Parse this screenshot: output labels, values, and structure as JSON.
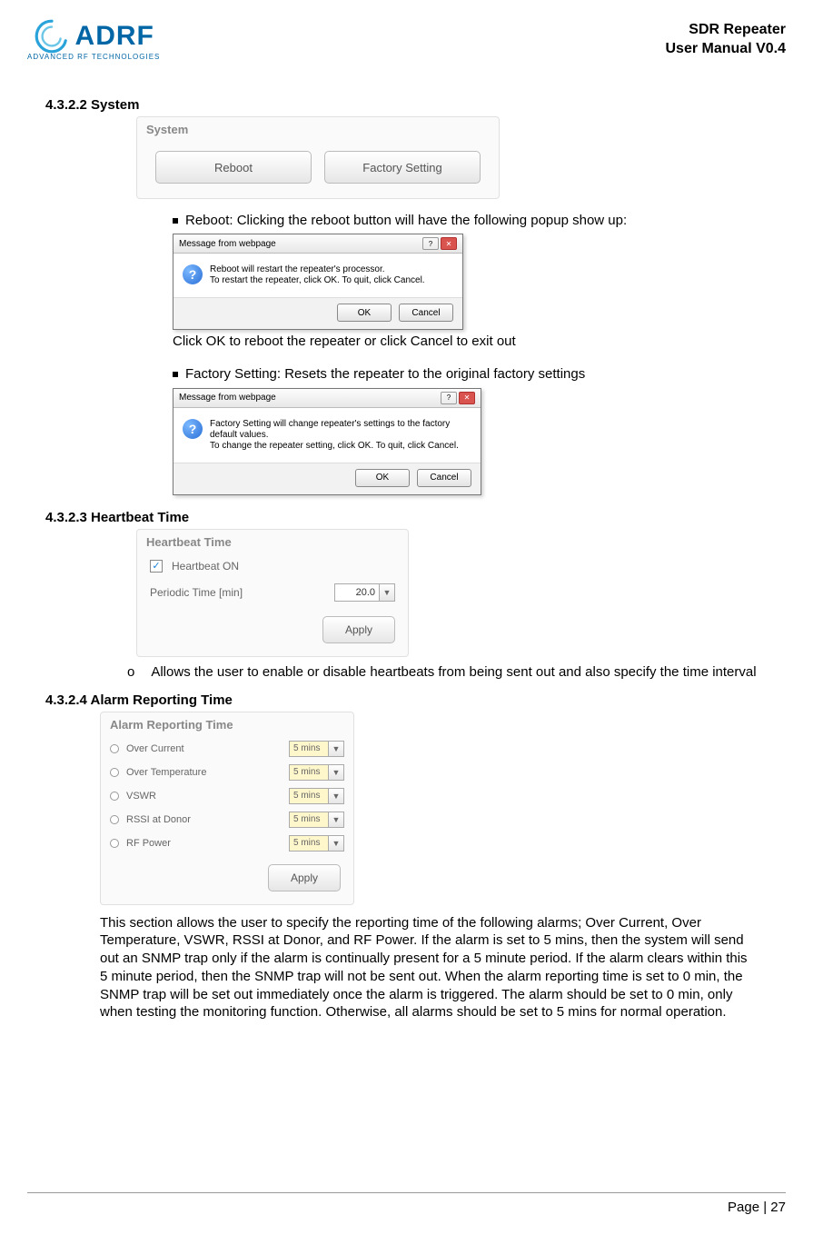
{
  "header": {
    "logo_text": "ADRF",
    "logo_sub": "ADVANCED RF TECHNOLOGIES",
    "title_line1": "SDR Repeater",
    "title_line2": "User Manual V0.4"
  },
  "sections": {
    "system": {
      "heading": "4.3.2.2 System",
      "panel_title": "System",
      "reboot_btn": "Reboot",
      "factory_btn": "Factory Setting",
      "reboot_bullet": "Reboot: Clicking the reboot button will have the following popup show up:",
      "reboot_popup": {
        "title": "Message from webpage",
        "line1": "Reboot will restart the repeater's processor.",
        "line2": "To restart the repeater, click OK. To quit, click Cancel.",
        "ok": "OK",
        "cancel": "Cancel"
      },
      "reboot_after": "Click OK to reboot the repeater or click Cancel to exit out",
      "factory_bullet": "Factory Setting: Resets the repeater to the original factory settings",
      "factory_popup": {
        "title": "Message from webpage",
        "line1": "Factory Setting will change repeater's settings to the factory default values.",
        "line2": "To change the repeater setting, click OK. To quit, click Cancel.",
        "ok": "OK",
        "cancel": "Cancel"
      }
    },
    "heartbeat": {
      "heading": "4.3.2.3 Heartbeat Time",
      "panel_title": "Heartbeat Time",
      "checkbox_label": "Heartbeat ON",
      "periodic_label": "Periodic Time  [min]",
      "periodic_value": "20.0",
      "apply": "Apply",
      "bullet_marker": "o",
      "bullet_text": "Allows the user to enable or disable heartbeats from being sent out and also specify the time interval"
    },
    "alarm": {
      "heading": "4.3.2.4 Alarm Reporting Time",
      "panel_title": "Alarm Reporting Time",
      "rows": [
        {
          "label": "Over Current",
          "value": "5 mins"
        },
        {
          "label": "Over Temperature",
          "value": "5 mins"
        },
        {
          "label": "VSWR",
          "value": "5 mins"
        },
        {
          "label": "RSSI at Donor",
          "value": "5 mins"
        },
        {
          "label": "RF Power",
          "value": "5 mins"
        }
      ],
      "apply": "Apply",
      "paragraph": "This section allows the user to specify the reporting time of the following alarms; Over Current, Over Temperature, VSWR, RSSI at Donor, and RF Power.   If the alarm is set to 5 mins, then the system will send out an SNMP trap only if the alarm is continually present for a 5 minute period.   If the alarm clears within this 5 minute period, then the SNMP trap will not be sent out.   When the alarm reporting time is set to 0 min, the SNMP trap will be set out immediately once the alarm is triggered.   The alarm should be set to 0 min, only when testing the monitoring function.   Otherwise, all alarms should be set to 5 mins for normal operation."
    }
  },
  "footer": {
    "page": "Page | 27"
  }
}
